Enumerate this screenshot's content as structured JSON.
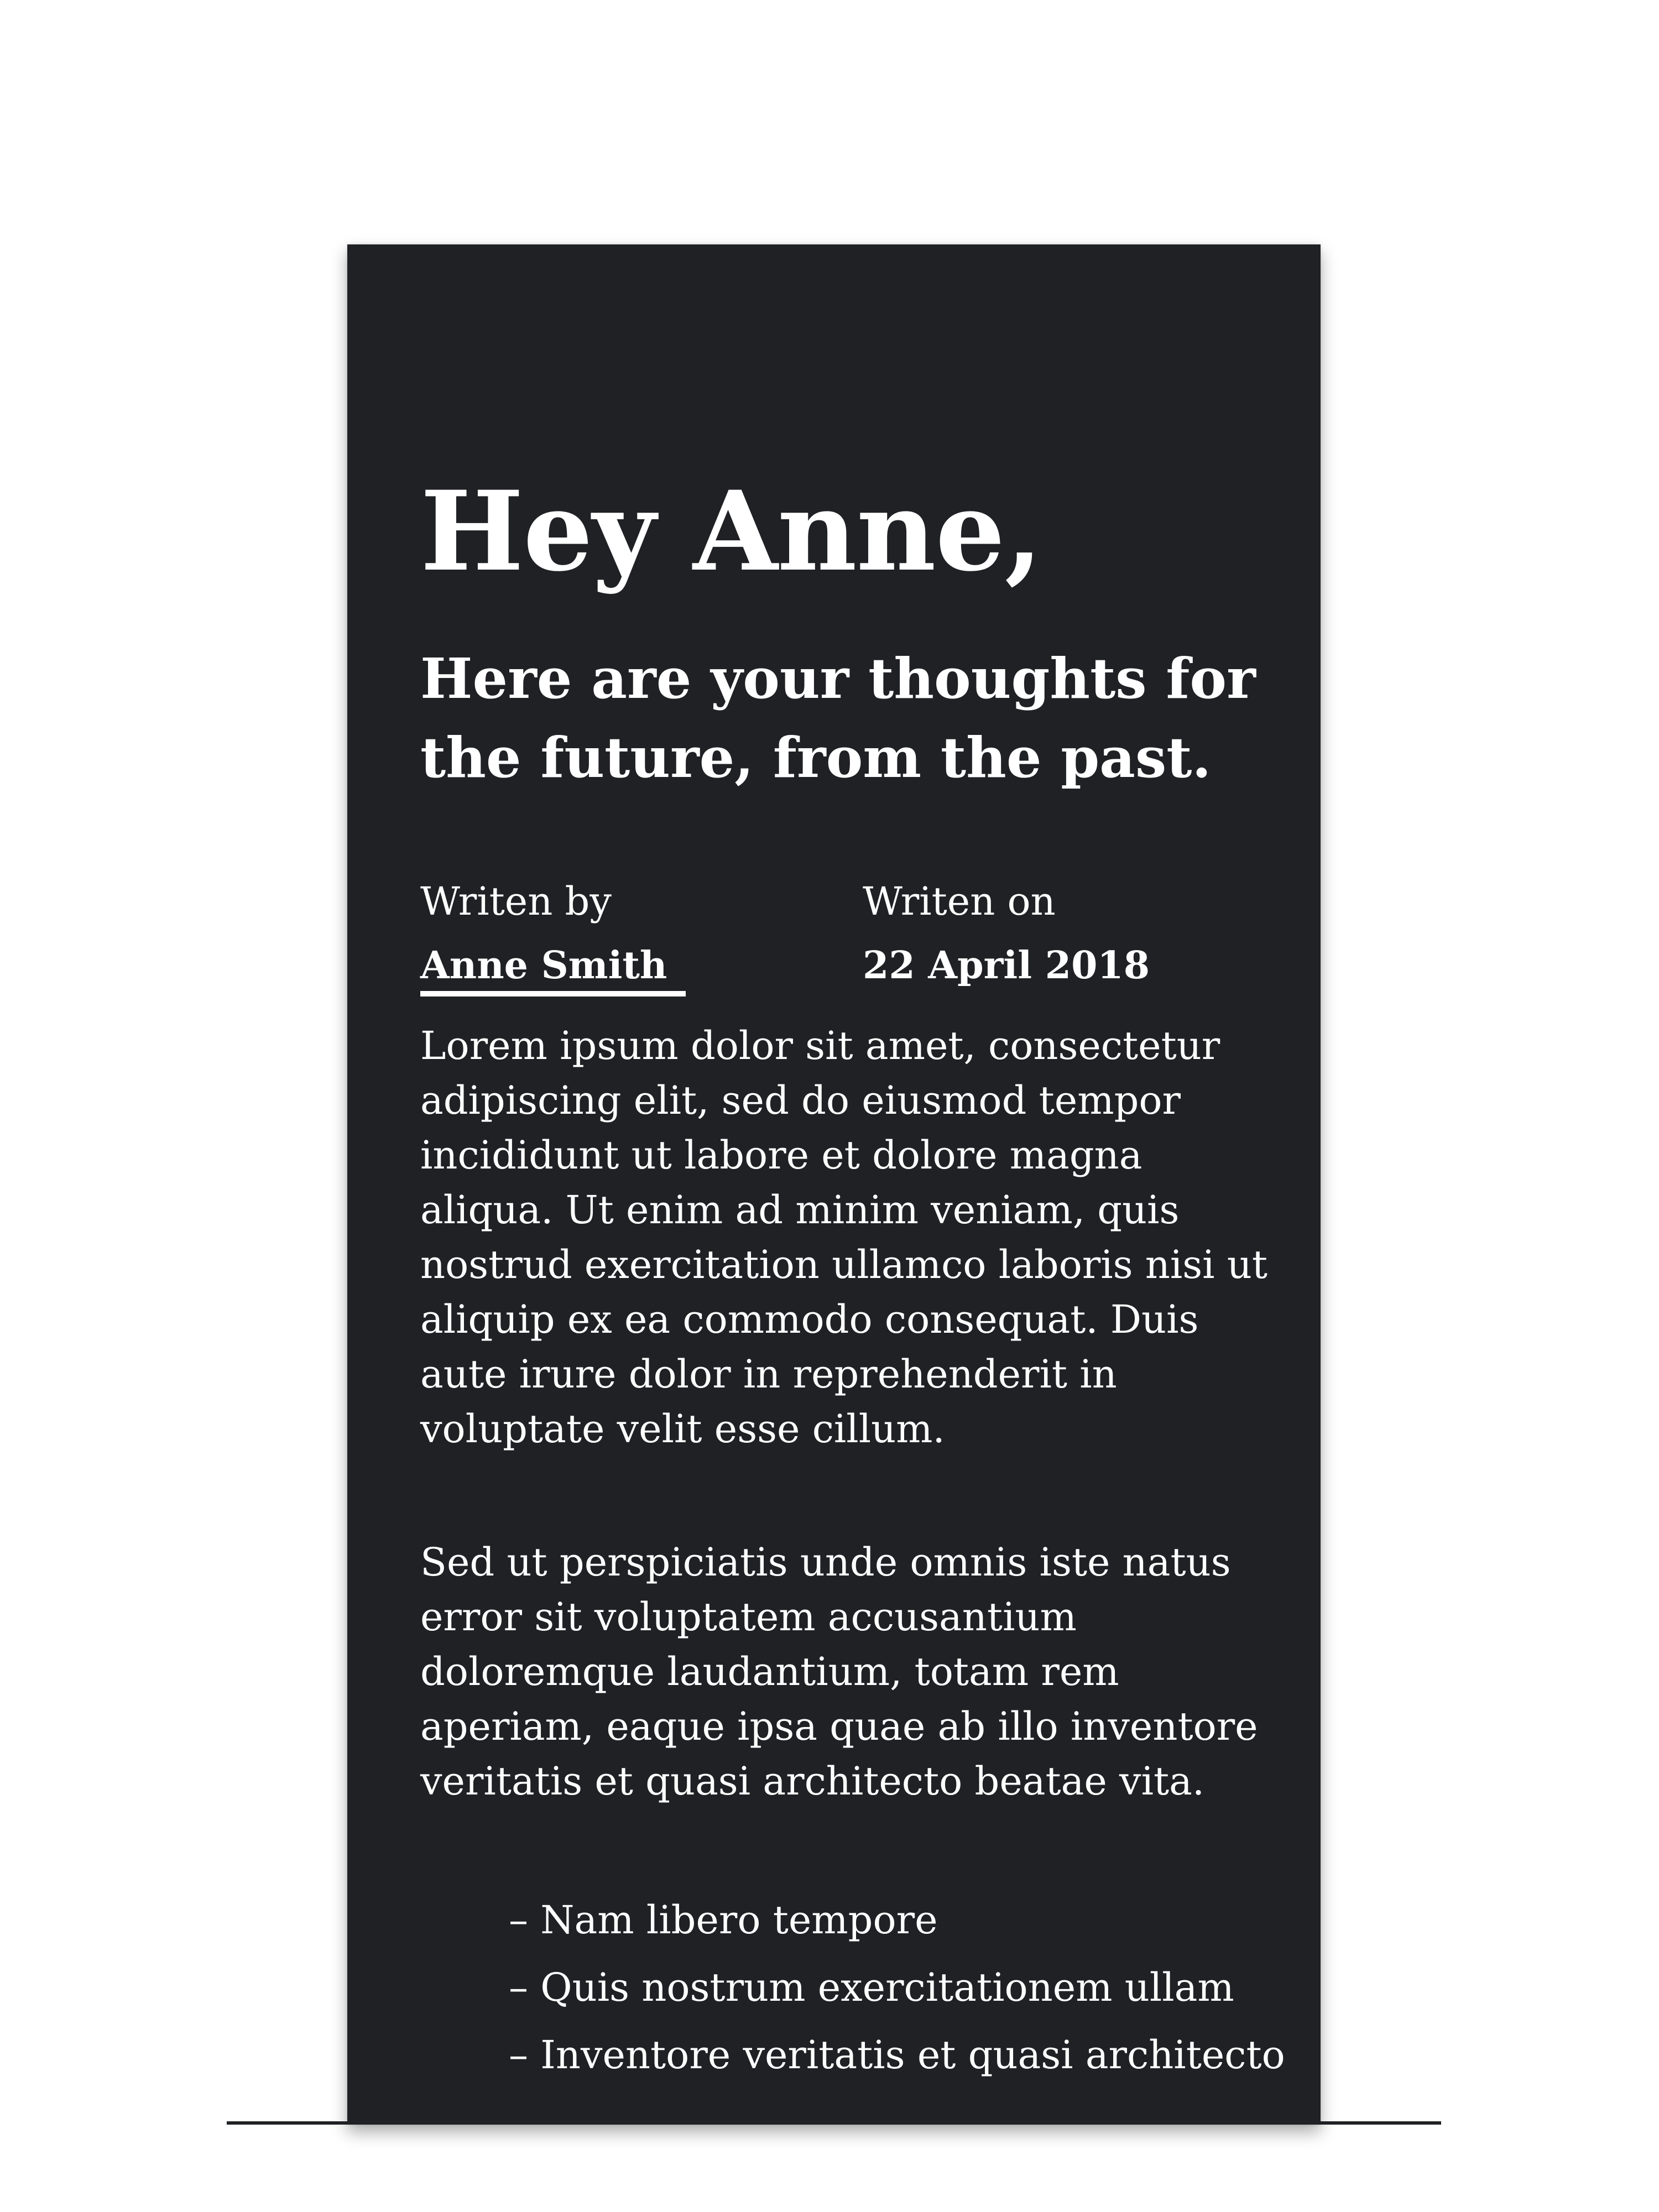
{
  "letter": {
    "greeting": "Hey Anne,",
    "subtitle": "Here are your thoughts for the future, from the past.",
    "written_by": {
      "label": "Writen by",
      "value": "Anne Smith"
    },
    "written_on": {
      "label": "Writen on",
      "value": "22 April 2018"
    },
    "paragraphs": [
      "Lorem ipsum dolor sit amet, consectetur adipiscing elit, sed do eiusmod tempor incididunt ut labore et dolore magna aliqua. Ut enim ad minim veniam, quis nostrud exercitation ullamco laboris nisi ut aliquip ex ea commodo consequat. Duis aute irure dolor in reprehenderit in voluptate velit esse cillum.",
      "Sed ut perspiciatis unde omnis iste natus error sit voluptatem accusantium doloremque laudantium, totam rem aperiam, eaque ipsa quae ab illo inventore veritatis et quasi architecto beatae vita."
    ],
    "list_items": [
      "– Nam libero tempore",
      "– Quis nostrum exercitationem ullam",
      "– Inventore veritatis et quasi architecto"
    ]
  },
  "colors": {
    "card_background": "#1f2125",
    "text": "#ffffff",
    "page_background": "#ffffff"
  }
}
